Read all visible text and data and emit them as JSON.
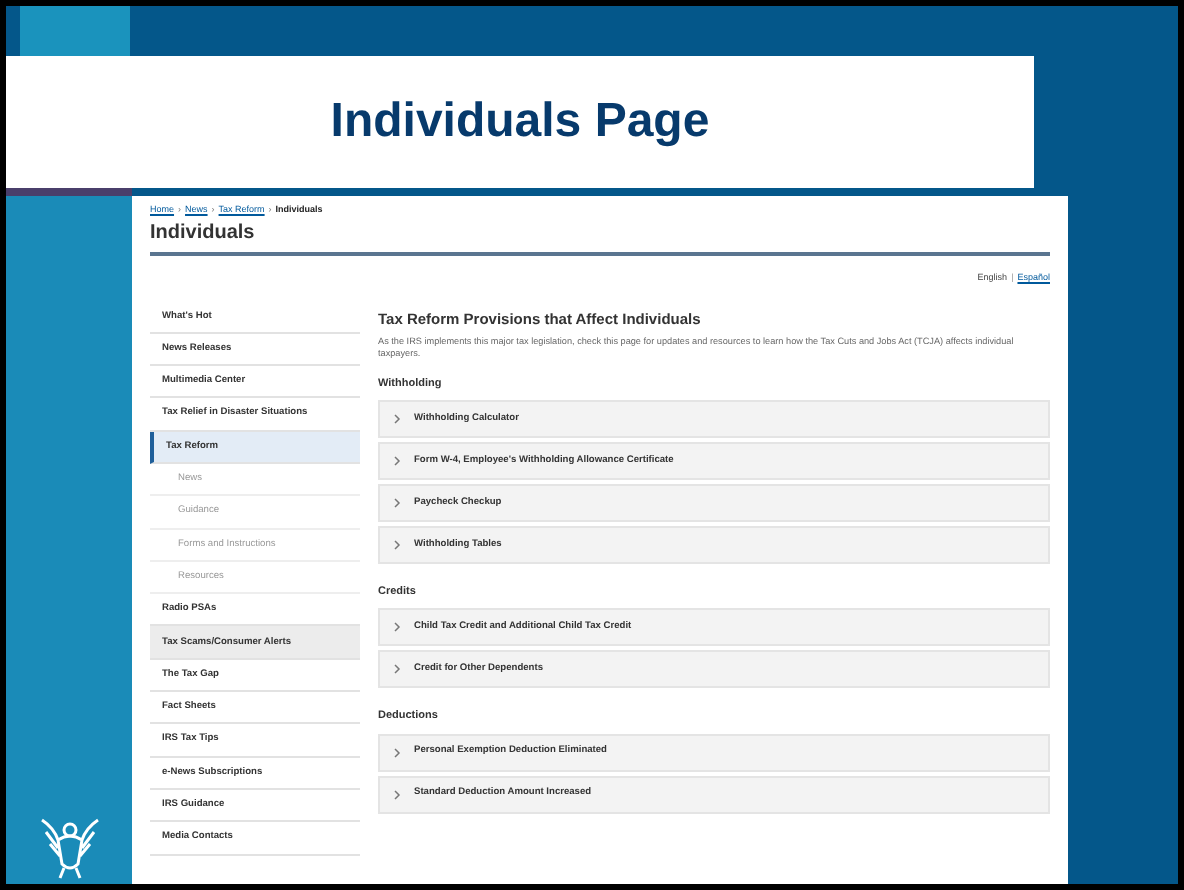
{
  "slide": {
    "title": "Individuals Page"
  },
  "page": {
    "breadcrumb_separator": "›",
    "language_separator": "|",
    "breadcrumb": [
      {
        "label": "Home",
        "link": true
      },
      {
        "label": "News",
        "link": true
      },
      {
        "label": "Tax Reform",
        "link": true
      },
      {
        "label": "Individuals",
        "link": false
      }
    ],
    "heading": "Individuals",
    "languages": [
      {
        "label": "English",
        "selected": true
      },
      {
        "label": "Español",
        "selected": false
      }
    ],
    "sidebar": {
      "items": [
        {
          "label": "What's Hot",
          "selected": false,
          "highlighted": false
        },
        {
          "label": "News Releases",
          "selected": false,
          "highlighted": false
        },
        {
          "label": "Multimedia Center",
          "selected": false,
          "highlighted": false
        },
        {
          "label": "Tax Relief in Disaster Situations",
          "selected": false,
          "highlighted": false
        },
        {
          "label": "Tax Reform",
          "selected": true,
          "expanded": true,
          "children": [
            {
              "label": "News",
              "selected": false
            },
            {
              "label": "Guidance",
              "selected": false
            },
            {
              "label": "Forms and Instructions",
              "selected": false
            },
            {
              "label": "Resources",
              "selected": false
            }
          ]
        },
        {
          "label": "Radio PSAs",
          "selected": false,
          "highlighted": false
        },
        {
          "label": "Tax Scams/Consumer Alerts",
          "selected": false,
          "highlighted": true
        },
        {
          "label": "The Tax Gap",
          "selected": false,
          "highlighted": false
        },
        {
          "label": "Fact Sheets",
          "selected": false,
          "highlighted": false
        },
        {
          "label": "IRS Tax Tips",
          "selected": false,
          "highlighted": false
        },
        {
          "label": "e-News Subscriptions",
          "selected": false,
          "highlighted": false
        },
        {
          "label": "IRS Guidance",
          "selected": false,
          "highlighted": false
        },
        {
          "label": "Media Contacts",
          "selected": false,
          "highlighted": false
        }
      ]
    },
    "content": {
      "title": "Tax Reform Provisions that Affect Individuals",
      "intro": "As the IRS implements this major tax legislation, check this page for updates and resources to learn how the Tax Cuts and Jobs Act (TCJA) affects individual taxpayers.",
      "sections": [
        {
          "heading": "Withholding",
          "items": [
            {
              "label": "Withholding Calculator",
              "expanded": false
            },
            {
              "label": "Form W-4, Employee's Withholding Allowance Certificate",
              "expanded": false
            },
            {
              "label": "Paycheck Checkup",
              "expanded": false
            },
            {
              "label": "Withholding Tables",
              "expanded": false
            }
          ]
        },
        {
          "heading": "Credits",
          "items": [
            {
              "label": "Child Tax Credit and Additional Child Tax Credit",
              "expanded": false
            },
            {
              "label": "Credit for Other Dependents",
              "expanded": false
            }
          ]
        },
        {
          "heading": "Deductions",
          "items": [
            {
              "label": "Personal Exemption Deduction Eliminated",
              "expanded": false
            },
            {
              "label": "Standard Deduction Amount Increased",
              "expanded": false
            }
          ]
        }
      ]
    }
  }
}
